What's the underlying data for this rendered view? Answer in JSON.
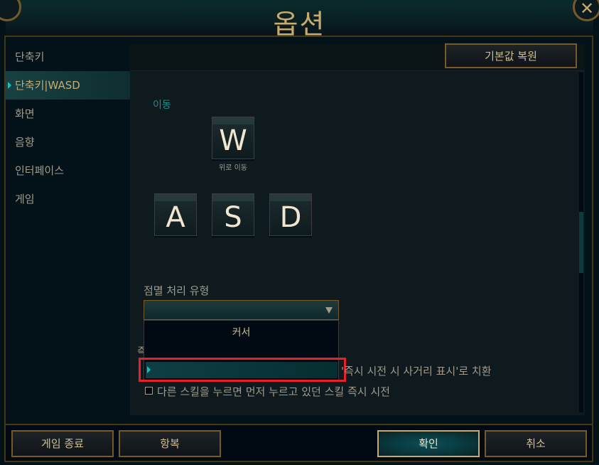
{
  "window": {
    "title": "옵션",
    "close_label": "✕"
  },
  "sidebar": {
    "items": [
      {
        "label": "단축키",
        "active": false
      },
      {
        "label": "단축키|WASD",
        "active": true
      },
      {
        "label": "화면",
        "active": false
      },
      {
        "label": "음향",
        "active": false
      },
      {
        "label": "인터페이스",
        "active": false
      },
      {
        "label": "게임",
        "active": false
      }
    ]
  },
  "panel": {
    "restore_button": "기본값 복원",
    "movement_label": "이동",
    "keys": {
      "w": "W",
      "a": "A",
      "s": "S",
      "d": "D"
    },
    "w_caption": "위로 이동",
    "target_type_label": "점멸 처리 유형",
    "dropdown": {
      "selected": "",
      "options": [
        "커서",
        ""
      ]
    },
    "partial_label": "즉",
    "option1_text": "'즉시 시전 시 사거리 표시'로 치환",
    "option2_text": "다른 스킬을 누르면 먼저 누르고 있던 스킬 즉시 시전"
  },
  "footer": {
    "exit_game": "게임 종료",
    "surrender": "항복",
    "ok": "확인",
    "cancel": "취소"
  },
  "colors": {
    "accent_gold": "#c8aa6e",
    "accent_teal": "#0ac8b9",
    "highlight_red": "#e8202a"
  }
}
